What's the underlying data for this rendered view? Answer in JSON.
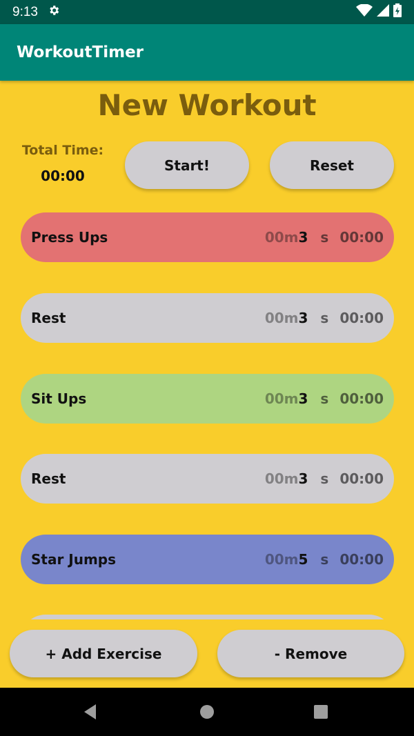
{
  "status_bar": {
    "time": "9:13",
    "icons": [
      "settings-icon",
      "wifi-icon",
      "signal-icon",
      "battery-icon"
    ]
  },
  "app_bar": {
    "title": "WorkoutTimer"
  },
  "main": {
    "title": "New Workout",
    "total_time_label": "Total Time:",
    "total_time_value": "00:00",
    "start_label": "Start!",
    "reset_label": "Reset"
  },
  "exercises": [
    {
      "name": "Press Ups",
      "min_prefix": "00m",
      "minutes": "3",
      "sec_label": "s",
      "countdown": "00:00",
      "color": "#E37272"
    },
    {
      "name": "Rest",
      "min_prefix": "00m",
      "minutes": "3",
      "sec_label": "s",
      "countdown": "00:00",
      "color": "#CFCDD1"
    },
    {
      "name": "Sit Ups",
      "min_prefix": "00m",
      "minutes": "3",
      "sec_label": "s",
      "countdown": "00:00",
      "color": "#AED581"
    },
    {
      "name": "Rest",
      "min_prefix": "00m",
      "minutes": "3",
      "sec_label": "s",
      "countdown": "00:00",
      "color": "#CFCDD1"
    },
    {
      "name": "Star Jumps",
      "min_prefix": "00m",
      "minutes": "5",
      "sec_label": "s",
      "countdown": "00:00",
      "color": "#7986CB"
    },
    {
      "name": "",
      "min_prefix": "",
      "minutes": "",
      "sec_label": "",
      "countdown": "",
      "color": "#CFCDD1"
    }
  ],
  "footer": {
    "add_label": "+ Add Exercise",
    "remove_label": "- Remove"
  },
  "nav_bar": {
    "icons": [
      "back-icon",
      "home-icon",
      "recents-icon"
    ]
  },
  "colors": {
    "background": "#F9CD2B",
    "app_bar": "#008577",
    "status_bar": "#00574B",
    "title_text": "#7A5D0E",
    "button": "#CFCDD1"
  }
}
